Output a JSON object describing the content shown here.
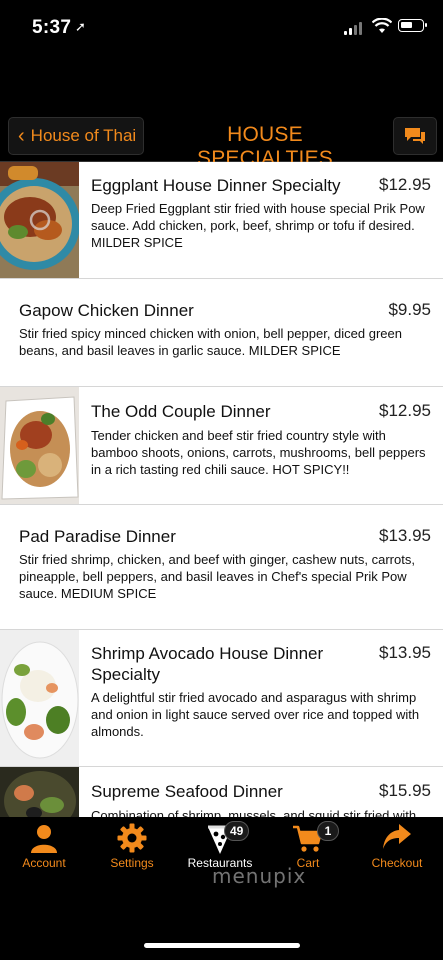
{
  "status_bar": {
    "time": "5:37"
  },
  "nav": {
    "back_label": "House of Thai",
    "title": "HOUSE SPECIALTIES"
  },
  "menu_items": [
    {
      "name": "Eggplant House Dinner Specialty",
      "price": "$12.95",
      "description": "Deep Fried Eggplant stir fried with house special Prik Pow sauce. Add chicken, pork, beef, shrimp or tofu if desired. MILDER SPICE"
    },
    {
      "name": "Gapow Chicken Dinner",
      "price": "$9.95",
      "description": "Stir fried spicy minced chicken with onion, bell pepper, diced green beans, and basil leaves in garlic sauce. MILDER SPICE"
    },
    {
      "name": "The Odd Couple Dinner",
      "price": "$12.95",
      "description": "Tender chicken and beef stir fried country style with bamboo shoots, onions, carrots, mushrooms, bell peppers in a rich tasting red chili sauce. HOT SPICY!!"
    },
    {
      "name": "Pad Paradise Dinner",
      "price": "$13.95",
      "description": "Stir fried shrimp, chicken, and beef with ginger, cashew nuts, carrots, pineapple, bell peppers, and basil leaves in Chef's special Prik Pow sauce. MEDIUM SPICE"
    },
    {
      "name": "Shrimp Avocado House Dinner Specialty",
      "price": "$13.95",
      "description": "A delightful stir fried avocado and asparagus with shrimp and onion in light sauce served over rice and topped with almonds."
    },
    {
      "name": "Supreme Seafood Dinner",
      "price": "$15.95",
      "description": "Combination of shrimp, mussels, and squid stir fried with"
    }
  ],
  "tab_bar": {
    "tabs": [
      {
        "label": "Account",
        "icon": "person-icon"
      },
      {
        "label": "Settings",
        "icon": "gear-icon"
      },
      {
        "label": "Restaurants",
        "icon": "pizza-slice-icon",
        "badge": "49"
      },
      {
        "label": "Cart",
        "icon": "cart-icon",
        "badge": "1"
      },
      {
        "label": "Checkout",
        "icon": "share-arrow-icon"
      }
    ],
    "watermark": "menupix"
  },
  "colors": {
    "accent": "#f28a1c",
    "background": "#000000",
    "list_background": "#ffffff"
  }
}
